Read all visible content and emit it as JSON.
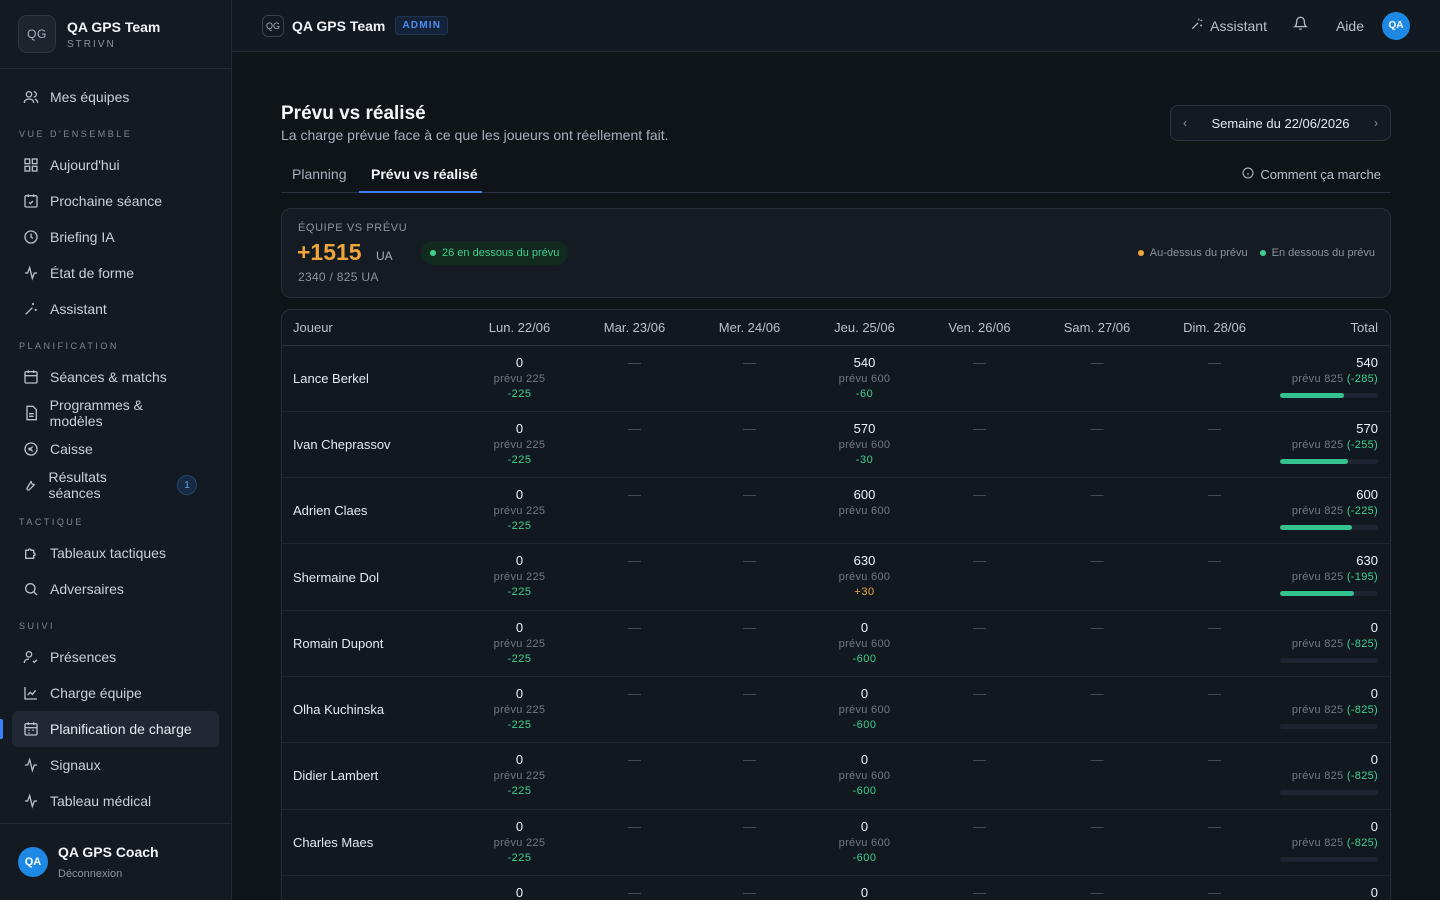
{
  "sidebar": {
    "brand": {
      "logo": "QG",
      "name": "QA GPS Team",
      "sub": "STRIVN"
    },
    "top_item": {
      "label": "Mes équipes",
      "icon": "users-icon"
    },
    "sections": [
      {
        "title": "VUE D'ENSEMBLE",
        "items": [
          {
            "label": "Aujourd'hui",
            "icon": "grid-icon"
          },
          {
            "label": "Prochaine séance",
            "icon": "calendar-check-icon"
          },
          {
            "label": "Briefing IA",
            "icon": "clock-icon"
          },
          {
            "label": "État de forme",
            "icon": "pulse-icon"
          },
          {
            "label": "Assistant",
            "icon": "sparkle-icon"
          }
        ]
      },
      {
        "title": "PLANIFICATION",
        "items": [
          {
            "label": "Séances & matchs",
            "icon": "calendar-icon"
          },
          {
            "label": "Programmes & modèles",
            "icon": "document-icon"
          },
          {
            "label": "Caisse",
            "icon": "euro-icon"
          },
          {
            "label": "Résultats séances",
            "icon": "wrench-icon",
            "badge": "1"
          }
        ]
      },
      {
        "title": "TACTIQUE",
        "items": [
          {
            "label": "Tableaux tactiques",
            "icon": "puzzle-icon"
          },
          {
            "label": "Adversaires",
            "icon": "search-icon"
          }
        ]
      },
      {
        "title": "SUIVI",
        "items": [
          {
            "label": "Présences",
            "icon": "user-check-icon"
          },
          {
            "label": "Charge équipe",
            "icon": "line-chart-icon"
          },
          {
            "label": "Planification de charge",
            "icon": "calendar-grid-icon",
            "active": true
          },
          {
            "label": "Signaux",
            "icon": "activity-icon"
          },
          {
            "label": "Tableau médical",
            "icon": "activity-icon"
          }
        ]
      }
    ],
    "footer": {
      "avatar": "QA",
      "name": "QA GPS Coach",
      "logout": "Déconnexion"
    }
  },
  "topbar": {
    "logo": "QG",
    "team": "QA GPS Team",
    "role": "ADMIN",
    "assistant": "Assistant",
    "help": "Aide",
    "avatar": "QA"
  },
  "page": {
    "title": "Prévu vs réalisé",
    "subtitle": "La charge prévue face à ce que les joueurs ont réellement fait.",
    "week_label": "Semaine du 22/06/2026",
    "tabs": [
      "Planning",
      "Prévu vs réalisé"
    ],
    "how_it_works": "Comment ça marche"
  },
  "summary": {
    "label": "ÉQUIPE VS PRÉVU",
    "value": "+1515",
    "unit": "UA",
    "pill": "26 en dessous du prévu",
    "ratio": "2340 / 825 UA",
    "legend_above": "Au-dessus du prévu",
    "legend_below": "En dessous du prévu",
    "colors": {
      "above": "#f0a63a",
      "below": "#3ecf8e"
    }
  },
  "table": {
    "headers": [
      "Joueur",
      "Lun. 22/06",
      "Mar. 23/06",
      "Mer. 24/06",
      "Jeu. 25/06",
      "Ven. 26/06",
      "Sam. 27/06",
      "Dim. 28/06",
      "Total"
    ],
    "dash": "—",
    "rows": [
      {
        "player": "Lance Berkel",
        "mon": {
          "v": "0",
          "p": "prévu 225",
          "d": "-225",
          "s": "neg"
        },
        "thu": {
          "v": "540",
          "p": "prévu 600",
          "d": "-60",
          "s": "neg"
        },
        "total": {
          "v": "540",
          "p": "prévu 825",
          "d": "(-285)",
          "progress": 0.65
        }
      },
      {
        "player": "Ivan Cheprassov",
        "mon": {
          "v": "0",
          "p": "prévu 225",
          "d": "-225",
          "s": "neg"
        },
        "thu": {
          "v": "570",
          "p": "prévu 600",
          "d": "-30",
          "s": "neg"
        },
        "total": {
          "v": "570",
          "p": "prévu 825",
          "d": "(-255)",
          "progress": 0.69
        }
      },
      {
        "player": "Adrien Claes",
        "mon": {
          "v": "0",
          "p": "prévu 225",
          "d": "-225",
          "s": "neg"
        },
        "thu": {
          "v": "600",
          "p": "prévu 600",
          "d": "",
          "s": "neg"
        },
        "total": {
          "v": "600",
          "p": "prévu 825",
          "d": "(-225)",
          "progress": 0.73
        }
      },
      {
        "player": "Shermaine Dol",
        "mon": {
          "v": "0",
          "p": "prévu 225",
          "d": "-225",
          "s": "neg"
        },
        "thu": {
          "v": "630",
          "p": "prévu 600",
          "d": "+30",
          "s": "pos"
        },
        "total": {
          "v": "630",
          "p": "prévu 825",
          "d": "(-195)",
          "progress": 0.76
        }
      },
      {
        "player": "Romain Dupont",
        "mon": {
          "v": "0",
          "p": "prévu 225",
          "d": "-225",
          "s": "neg"
        },
        "thu": {
          "v": "0",
          "p": "prévu 600",
          "d": "-600",
          "s": "neg"
        },
        "total": {
          "v": "0",
          "p": "prévu 825",
          "d": "(-825)",
          "progress": 0
        }
      },
      {
        "player": "Olha Kuchinska",
        "mon": {
          "v": "0",
          "p": "prévu 225",
          "d": "-225",
          "s": "neg"
        },
        "thu": {
          "v": "0",
          "p": "prévu 600",
          "d": "-600",
          "s": "neg"
        },
        "total": {
          "v": "0",
          "p": "prévu 825",
          "d": "(-825)",
          "progress": 0
        }
      },
      {
        "player": "Didier Lambert",
        "mon": {
          "v": "0",
          "p": "prévu 225",
          "d": "-225",
          "s": "neg"
        },
        "thu": {
          "v": "0",
          "p": "prévu 600",
          "d": "-600",
          "s": "neg"
        },
        "total": {
          "v": "0",
          "p": "prévu 825",
          "d": "(-825)",
          "progress": 0
        }
      },
      {
        "player": "Charles Maes",
        "mon": {
          "v": "0",
          "p": "prévu 225",
          "d": "-225",
          "s": "neg"
        },
        "thu": {
          "v": "0",
          "p": "prévu 600",
          "d": "-600",
          "s": "neg"
        },
        "total": {
          "v": "0",
          "p": "prévu 825",
          "d": "(-825)",
          "progress": 0
        }
      },
      {
        "player": "",
        "mon": {
          "v": "0",
          "p": "",
          "d": "",
          "s": "neg"
        },
        "thu": {
          "v": "0",
          "p": "",
          "d": "",
          "s": "neg"
        },
        "total": {
          "v": "0",
          "p": "",
          "d": "",
          "progress": 0
        }
      }
    ]
  }
}
